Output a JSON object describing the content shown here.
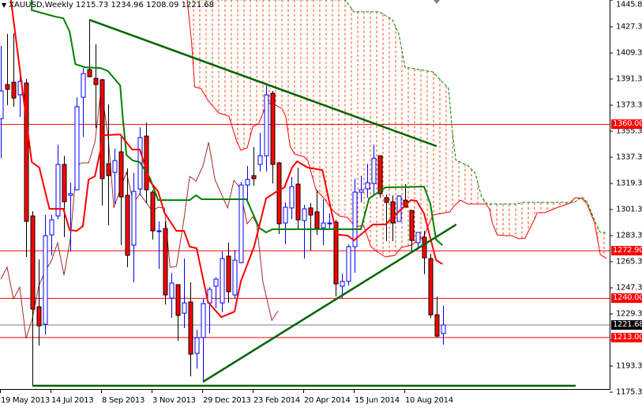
{
  "header": {
    "symbol": "XAUUSD,Weekly",
    "open": "1215.73",
    "high": "1234.96",
    "low": "1208.09",
    "close": "1221.68"
  },
  "colors": {
    "bull": "#0000ff",
    "bear": "#ff0000",
    "tenkan": "#ff0000",
    "kijun": "#008000",
    "chikou": "#a52a2a",
    "cloud": "#ff4500",
    "trendline": "#006400",
    "level": "#ff0000",
    "bid": "#708090"
  },
  "chart_data": {
    "type": "candlestick",
    "title": "XAUUSD,Weekly",
    "ylim": [
      1175.3,
      1445.8
    ],
    "y_ticks": [
      "1445.80",
      "1427.30",
      "1409.30",
      "1391.30",
      "1373.30",
      "1355.30",
      "1337.30",
      "1319.30",
      "1301.30",
      "1283.30",
      "1265.30",
      "1247.30",
      "1229.30",
      "1211.30",
      "1193.30",
      "1175.30"
    ],
    "x_ticks": [
      {
        "bar": 0,
        "label": "19 May 2013"
      },
      {
        "bar": 8,
        "label": "14 Jul 2013"
      },
      {
        "bar": 16,
        "label": "8 Sep 2013"
      },
      {
        "bar": 24,
        "label": "3 Nov 2013"
      },
      {
        "bar": 32,
        "label": "29 Dec 2013"
      },
      {
        "bar": 40,
        "label": "23 Feb 2014"
      },
      {
        "bar": 48,
        "label": "20 Apr 2014"
      },
      {
        "bar": 56,
        "label": "15 Jun 2014"
      },
      {
        "bar": 64,
        "label": "10 Aug 2014"
      }
    ],
    "ohlc": [
      [
        1364.0,
        1414.2,
        1336.7,
        1383.1
      ],
      [
        1387.5,
        1422.4,
        1373.3,
        1384.2
      ],
      [
        1389.1,
        1422.9,
        1372.2,
        1378.2
      ],
      [
        1380.4,
        1394.0,
        1365.1,
        1389.7
      ],
      [
        1388.6,
        1391.3,
        1268.6,
        1293.1
      ],
      [
        1296.9,
        1300.2,
        1179.7,
        1232.6
      ],
      [
        1234.2,
        1266.9,
        1207.5,
        1221.1
      ],
      [
        1222.2,
        1297.5,
        1215.1,
        1283.3
      ],
      [
        1283.8,
        1297.5,
        1269.7,
        1294.2
      ],
      [
        1296.9,
        1346.0,
        1294.7,
        1332.4
      ],
      [
        1332.4,
        1338.4,
        1282.2,
        1306.7
      ],
      [
        1311.1,
        1319.8,
        1272.4,
        1312.2
      ],
      [
        1314.9,
        1378.7,
        1314.9,
        1372.2
      ],
      [
        1378.7,
        1398.9,
        1351.5,
        1395.1
      ],
      [
        1397.8,
        1432.2,
        1392.9,
        1392.9
      ],
      [
        1391.8,
        1415.3,
        1357.5,
        1387.5
      ],
      [
        1390.8,
        1391.3,
        1304.0,
        1322.6
      ],
      [
        1332.9,
        1373.8,
        1290.4,
        1324.7
      ],
      [
        1326.9,
        1343.3,
        1305.1,
        1335.1
      ],
      [
        1341.1,
        1351.5,
        1276.7,
        1310.0
      ],
      [
        1311.1,
        1329.7,
        1261.5,
        1269.7
      ],
      [
        1276.7,
        1326.4,
        1251.1,
        1313.8
      ],
      [
        1315.5,
        1358.0,
        1311.1,
        1350.9
      ],
      [
        1352.0,
        1361.3,
        1305.7,
        1314.9
      ],
      [
        1313.3,
        1314.9,
        1280.6,
        1286.6
      ],
      [
        1286.6,
        1293.1,
        1260.4,
        1286.6
      ],
      [
        1288.2,
        1293.1,
        1235.8,
        1242.4
      ],
      [
        1240.2,
        1257.6,
        1226.6,
        1250.6
      ],
      [
        1249.5,
        1249.5,
        1210.7,
        1228.2
      ],
      [
        1229.8,
        1267.5,
        1219.5,
        1236.9
      ],
      [
        1237.5,
        1251.1,
        1186.2,
        1201.5
      ],
      [
        1202.0,
        1218.4,
        1191.6,
        1212.9
      ],
      [
        1212.9,
        1239.7,
        1182.4,
        1236.4
      ],
      [
        1236.9,
        1247.8,
        1215.7,
        1246.2
      ],
      [
        1248.4,
        1254.4,
        1233.1,
        1253.3
      ],
      [
        1236.9,
        1272.4,
        1230.4,
        1267.5
      ],
      [
        1269.1,
        1278.4,
        1236.9,
        1244.6
      ],
      [
        1242.4,
        1273.5,
        1239.7,
        1266.4
      ],
      [
        1264.7,
        1320.4,
        1264.2,
        1318.2
      ],
      [
        1318.2,
        1331.3,
        1307.8,
        1322.0
      ],
      [
        1324.7,
        1344.4,
        1317.7,
        1322.6
      ],
      [
        1332.4,
        1354.2,
        1327.5,
        1338.4
      ],
      [
        1338.4,
        1387.5,
        1327.5,
        1380.4
      ],
      [
        1381.5,
        1383.1,
        1319.3,
        1332.4
      ],
      [
        1333.5,
        1334.0,
        1284.4,
        1291.5
      ],
      [
        1292.0,
        1306.2,
        1277.3,
        1302.9
      ],
      [
        1302.4,
        1323.7,
        1294.7,
        1317.1
      ],
      [
        1318.8,
        1330.2,
        1288.2,
        1294.2
      ],
      [
        1293.7,
        1304.6,
        1267.5,
        1301.8
      ],
      [
        1302.4,
        1305.7,
        1272.9,
        1297.5
      ],
      [
        1299.7,
        1314.9,
        1283.8,
        1288.2
      ],
      [
        1288.7,
        1308.4,
        1276.7,
        1292.0
      ],
      [
        1292.0,
        1298.6,
        1287.7,
        1292.0
      ],
      [
        1292.6,
        1294.2,
        1241.3,
        1250.0
      ],
      [
        1248.4,
        1257.1,
        1240.2,
        1251.7
      ],
      [
        1251.7,
        1277.3,
        1248.9,
        1275.7
      ],
      [
        1275.7,
        1322.6,
        1257.6,
        1313.3
      ],
      [
        1313.3,
        1324.7,
        1306.2,
        1314.9
      ],
      [
        1315.5,
        1332.9,
        1309.5,
        1319.8
      ],
      [
        1319.3,
        1346.0,
        1311.1,
        1336.7
      ],
      [
        1338.4,
        1338.4,
        1309.5,
        1312.2
      ],
      [
        1309.5,
        1311.7,
        1279.5,
        1306.2
      ],
      [
        1306.7,
        1311.1,
        1279.5,
        1292.0
      ],
      [
        1293.1,
        1311.1,
        1293.1,
        1310.6
      ],
      [
        1307.8,
        1318.8,
        1302.9,
        1302.9
      ],
      [
        1300.7,
        1300.7,
        1272.9,
        1280.0
      ],
      [
        1278.4,
        1285.5,
        1275.1,
        1285.5
      ],
      [
        1282.2,
        1286.6,
        1256.6,
        1268.0
      ],
      [
        1267.5,
        1270.7,
        1226.6,
        1228.7
      ],
      [
        1228.7,
        1241.3,
        1212.9,
        1214.0
      ],
      [
        1215.73,
        1234.96,
        1208.09,
        1221.68
      ]
    ],
    "tenkan": [
      [
        1.6,
        1446
      ],
      [
        4.9,
        1334.0
      ],
      [
        6.1,
        1330.2
      ],
      [
        7.7,
        1301.8
      ],
      [
        9.9,
        1301.8
      ],
      [
        10.9,
        1287.1
      ],
      [
        12,
        1286.6
      ],
      [
        13,
        1289.9
      ],
      [
        13.9,
        1322.0
      ],
      [
        14.9,
        1324.2
      ],
      [
        15.8,
        1342.7
      ],
      [
        16.1,
        1352.5
      ],
      [
        18.9,
        1353.1
      ],
      [
        20.8,
        1342.7
      ],
      [
        22,
        1342.7
      ],
      [
        23.6,
        1320.9
      ],
      [
        24.9,
        1313.8
      ],
      [
        25.9,
        1299.1
      ],
      [
        27.8,
        1286.6
      ],
      [
        29,
        1286.6
      ],
      [
        29.9,
        1275.7
      ],
      [
        31,
        1274.6
      ],
      [
        32.8,
        1237.5
      ],
      [
        34.9,
        1227.1
      ],
      [
        37,
        1230.9
      ],
      [
        38,
        1251.7
      ],
      [
        40.1,
        1275.7
      ],
      [
        42,
        1309.0
      ],
      [
        43.9,
        1314.4
      ],
      [
        44.9,
        1316.6
      ],
      [
        46.1,
        1330.2
      ],
      [
        46.9,
        1334.6
      ],
      [
        48.6,
        1330.2
      ],
      [
        50.9,
        1328.6
      ],
      [
        52.8,
        1291.0
      ],
      [
        53.4,
        1284.0
      ],
      [
        54.9,
        1283.3
      ],
      [
        55.9,
        1280.0
      ],
      [
        58.9,
        1291.0
      ],
      [
        60.9,
        1291.0
      ],
      [
        64.9,
        1307.8
      ],
      [
        65.8,
        1307.3
      ],
      [
        67,
        1298.6
      ],
      [
        68.9,
        1266.4
      ],
      [
        69.9,
        1263.7
      ]
    ],
    "kijun": [
      [
        4.9,
        1446
      ],
      [
        4.9,
        1438.8
      ],
      [
        8.6,
        1434.4
      ],
      [
        9.9,
        1433.3
      ],
      [
        10.9,
        1424.0
      ],
      [
        11.8,
        1401.6
      ],
      [
        13.3,
        1399.4
      ],
      [
        15.8,
        1398.9
      ],
      [
        17,
        1396.7
      ],
      [
        18.9,
        1386.9
      ],
      [
        19.3,
        1365.1
      ],
      [
        19.9,
        1338.9
      ],
      [
        20.9,
        1335.1
      ],
      [
        22,
        1334.0
      ],
      [
        23.6,
        1323.1
      ],
      [
        24.9,
        1307.8
      ],
      [
        29.9,
        1307.8
      ],
      [
        30.9,
        1311.1
      ],
      [
        31.8,
        1308.4
      ],
      [
        38.9,
        1308.4
      ],
      [
        40.9,
        1288.7
      ],
      [
        42,
        1285.5
      ],
      [
        43,
        1287.7
      ],
      [
        48.6,
        1287.7
      ],
      [
        57.0,
        1287.7
      ],
      [
        58.3,
        1309.0
      ],
      [
        60.9,
        1316.6
      ],
      [
        67,
        1317.1
      ],
      [
        68,
        1305.1
      ],
      [
        68.9,
        1280.6
      ],
      [
        69.9,
        1276.7
      ]
    ],
    "chikou": [
      [
        0,
        1253.3
      ],
      [
        1,
        1261.5
      ],
      [
        2,
        1239.7
      ],
      [
        3,
        1247.8
      ],
      [
        4,
        1212.4
      ],
      [
        5,
        1226.0
      ],
      [
        6,
        1248.4
      ],
      [
        7,
        1258.7
      ],
      [
        8,
        1265.8
      ],
      [
        9,
        1278.4
      ],
      [
        10,
        1256.0
      ],
      [
        11,
        1280.6
      ],
      [
        12,
        1331.3
      ],
      [
        12.8,
        1333.5
      ],
      [
        13.9,
        1333.5
      ],
      [
        14.9,
        1347.7
      ],
      [
        15.9,
        1384.7
      ],
      [
        17,
        1351.5
      ],
      [
        17.9,
        1302.4
      ],
      [
        19,
        1316.6
      ],
      [
        19.9,
        1327.0
      ],
      [
        21,
        1305.7
      ],
      [
        22,
        1312.2
      ],
      [
        24,
        1300.2
      ],
      [
        24.9,
        1302.9
      ],
      [
        25.9,
        1302.4
      ],
      [
        26.8,
        1261.5
      ],
      [
        27.8,
        1262.1
      ],
      [
        29,
        1294.7
      ],
      [
        29.9,
        1324.2
      ],
      [
        30.9,
        1320.9
      ],
      [
        32,
        1331.3
      ],
      [
        32.9,
        1347.7
      ],
      [
        33.9,
        1322.0
      ],
      [
        35.9,
        1302.4
      ],
      [
        36.9,
        1321.5
      ],
      [
        37.8,
        1316.6
      ],
      [
        39,
        1291.5
      ],
      [
        39.9,
        1296.4
      ],
      [
        40.5,
        1291.5
      ],
      [
        41.5,
        1251.1
      ],
      [
        42.9,
        1224.9
      ],
      [
        43.9,
        1231.5
      ]
    ],
    "senkou_upper": [
      [
        29.5,
        1446
      ],
      [
        54.5,
        1446
      ],
      [
        55.9,
        1437.7
      ],
      [
        59.9,
        1437.7
      ],
      [
        62,
        1432.2
      ],
      [
        63,
        1422.4
      ],
      [
        64,
        1399.4
      ],
      [
        65.5,
        1398.4
      ],
      [
        68.4,
        1396.2
      ],
      [
        70.9,
        1384.7
      ],
      [
        71.4,
        1358.6
      ],
      [
        72,
        1335.6
      ],
      [
        72.8,
        1333.9
      ],
      [
        73.9,
        1331.8
      ],
      [
        75.1,
        1326.4
      ],
      [
        76.1,
        1310.0
      ],
      [
        77,
        1305.1
      ],
      [
        81.5,
        1305.1
      ],
      [
        82.8,
        1306.2
      ],
      [
        90.8,
        1306.2
      ],
      [
        92,
        1310.0
      ],
      [
        92.8,
        1306.7
      ],
      [
        94,
        1293.7
      ],
      [
        94.9,
        1285.5
      ],
      [
        95.9,
        1285.5
      ]
    ],
    "senkou_lower": [
      [
        29.5,
        1446
      ],
      [
        30.2,
        1417.0
      ],
      [
        30.7,
        1385.9
      ],
      [
        31.7,
        1384.7
      ],
      [
        32.8,
        1376.6
      ],
      [
        34.5,
        1367.9
      ],
      [
        36.1,
        1365.7
      ],
      [
        37.4,
        1347.7
      ],
      [
        38,
        1342.2
      ],
      [
        39,
        1343.8
      ],
      [
        39.9,
        1358.6
      ],
      [
        40.8,
        1360.2
      ],
      [
        42,
        1373.3
      ],
      [
        42.8,
        1374.9
      ],
      [
        44.5,
        1371.0
      ],
      [
        45.1,
        1365.7
      ],
      [
        45.8,
        1345.0
      ],
      [
        46.5,
        1339.5
      ],
      [
        48,
        1337.8
      ],
      [
        48.6,
        1335.1
      ],
      [
        49.9,
        1314.9
      ],
      [
        51.1,
        1309.5
      ],
      [
        52.4,
        1301.3
      ],
      [
        53.6,
        1296.9
      ],
      [
        54.9,
        1295.8
      ],
      [
        56.1,
        1289.3
      ],
      [
        57.4,
        1290.4
      ],
      [
        58.6,
        1275.7
      ],
      [
        59.5,
        1272.4
      ],
      [
        60.9,
        1268.6
      ],
      [
        62.4,
        1269.7
      ],
      [
        63.4,
        1275.1
      ],
      [
        64.9,
        1276.7
      ],
      [
        66.9,
        1282.2
      ],
      [
        68.4,
        1297.5
      ],
      [
        71.1,
        1299.7
      ],
      [
        71.8,
        1304.0
      ],
      [
        72.8,
        1307.8
      ],
      [
        73.9,
        1305.1
      ],
      [
        74.9,
        1305.1
      ],
      [
        76.8,
        1305.1
      ],
      [
        77.4,
        1301.3
      ],
      [
        77.8,
        1292.0
      ],
      [
        78.6,
        1283.8
      ],
      [
        79.9,
        1283.3
      ],
      [
        80.9,
        1283.3
      ],
      [
        82,
        1281.1
      ],
      [
        83,
        1281.6
      ],
      [
        84.5,
        1294.7
      ],
      [
        84.9,
        1299.1
      ],
      [
        86.1,
        1299.1
      ],
      [
        88.2,
        1302.9
      ],
      [
        90.1,
        1305.7
      ],
      [
        90.9,
        1309.5
      ],
      [
        92,
        1308.9
      ],
      [
        92.8,
        1305.1
      ],
      [
        94,
        1292.0
      ],
      [
        94.9,
        1270.2
      ],
      [
        95.9,
        1267.5
      ]
    ],
    "trendlines": [
      {
        "name": "down-trendline",
        "from": [
          14,
          1432.2
        ],
        "to": [
          69,
          1345.0
        ]
      },
      {
        "name": "up-trendline",
        "from": [
          32,
          1182.4
        ],
        "to": [
          72.1,
          1291.0
        ]
      },
      {
        "name": "bottom-support-line",
        "from": [
          5,
          1179.7
        ],
        "to": [
          91,
          1179.7
        ]
      }
    ],
    "levels": [
      {
        "price": 1360.0,
        "label": "1360.00"
      },
      {
        "price": 1272.9,
        "label": "1272.90"
      },
      {
        "price": 1240.0,
        "label": "1240.00"
      },
      {
        "price": 1213.0,
        "label": "1213.00"
      }
    ],
    "bid": {
      "price": 1221.68,
      "label": "1221.68"
    }
  }
}
